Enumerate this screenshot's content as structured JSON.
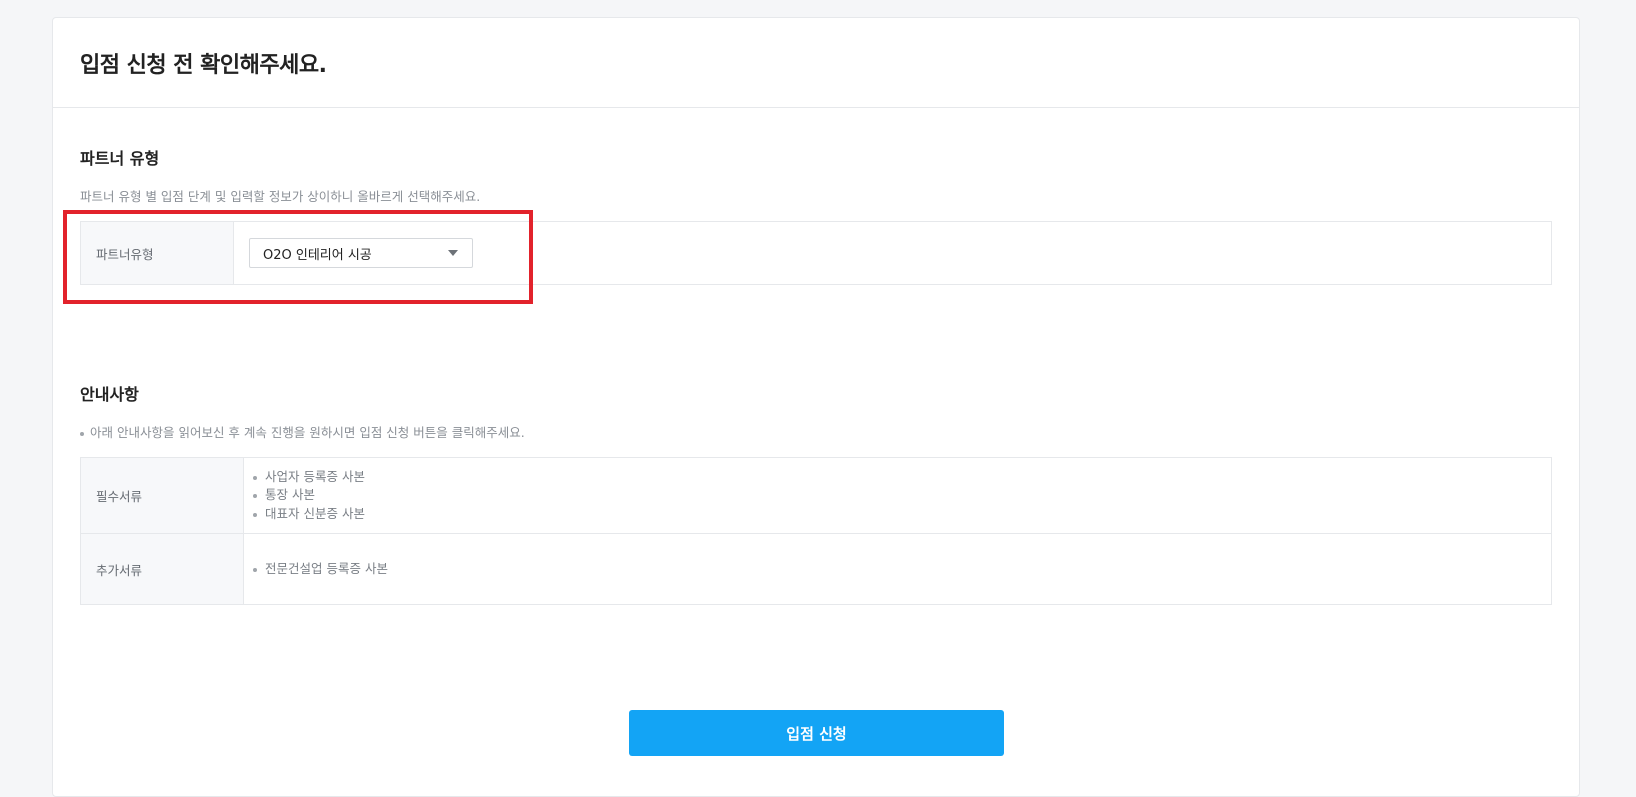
{
  "header": {
    "title": "입점 신청 전 확인해주세요."
  },
  "partner_section": {
    "title": "파트너 유형",
    "description": "파트너 유형 별 입점 단계 및 입력할 정보가 상이하니 올바르게 선택해주세요.",
    "field_label": "파트너유형",
    "selected_value": "O2O 인테리어 시공"
  },
  "notice_section": {
    "title": "안내사항",
    "description": "아래 안내사항을 읽어보신 후 계속 진행을 원하시면 입점 신청 버튼을 클릭해주세요.",
    "rows": [
      {
        "label": "필수서류",
        "items": [
          "사업자 등록증 사본",
          "통장 사본",
          "대표자 신분증 사본"
        ]
      },
      {
        "label": "추가서류",
        "items": [
          "전문건설업 등록증 사본"
        ]
      }
    ]
  },
  "submit": {
    "label": "입점 신청"
  },
  "colors": {
    "accent": "#13a4f5",
    "highlight": "#e2222b"
  }
}
